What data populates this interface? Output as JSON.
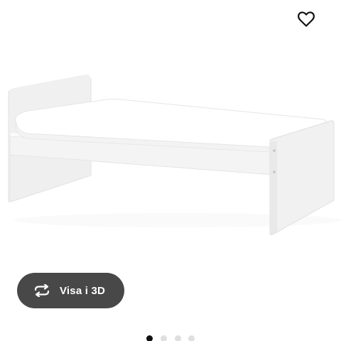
{
  "gallery": {
    "view_3d_label": "Visa i 3D",
    "dots_total": 4,
    "active_dot": 0
  },
  "icons": {
    "favorite": "heart-outline-icon",
    "view_3d": "rotate-360-icon"
  },
  "colors": {
    "pill_background": "#484848",
    "pill_text": "#ffffff",
    "dot_active": "#111111",
    "dot_inactive": "#dfdfdf"
  }
}
